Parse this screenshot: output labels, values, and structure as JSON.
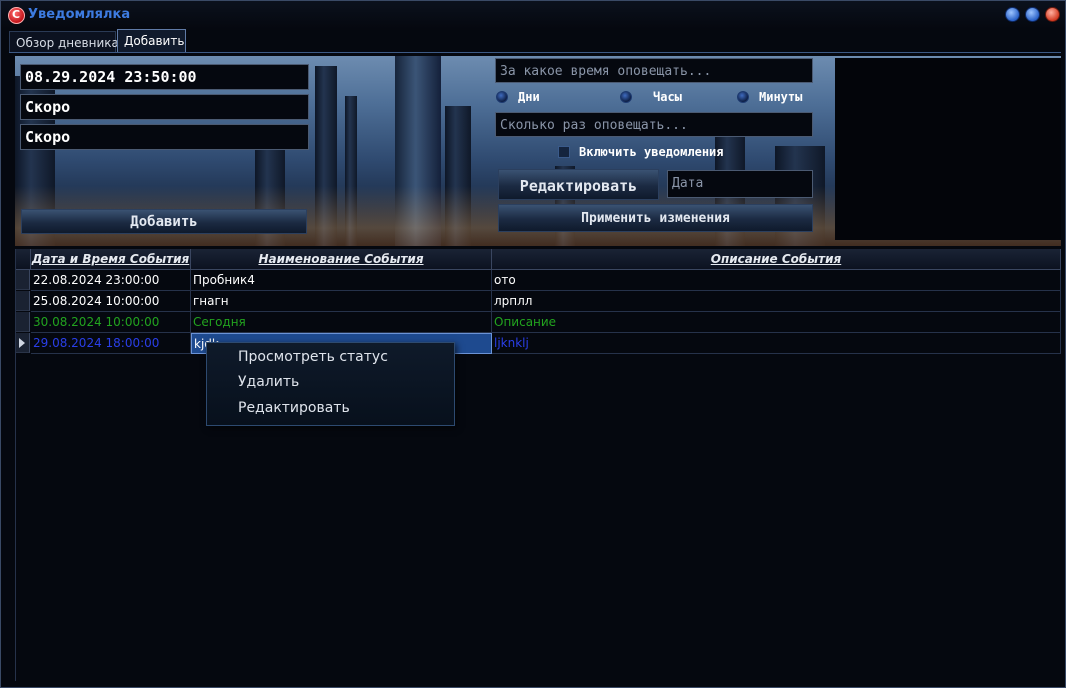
{
  "window": {
    "title": "Уведомлялка",
    "controls": [
      "minimize-button",
      "maximize-button",
      "close-button"
    ]
  },
  "tabs": [
    {
      "label": "Обзор дневника",
      "active": false
    },
    {
      "label": "Добавить",
      "active": true
    }
  ],
  "form": {
    "datetime_value": "08.29.2024 23:50:00",
    "name_value": "Скоро",
    "description_value": "Скоро",
    "add_button": "Добавить",
    "notify_time_placeholder": "За какое время оповещать...",
    "radio_options": [
      "Дни",
      "Часы",
      "Минуты"
    ],
    "repeat_placeholder": "Сколько раз оповещать...",
    "enable_notifications_label": "Включить уведомления",
    "enable_notifications_checked": false,
    "edit_button": "Редактировать",
    "date_placeholder": "Дата",
    "apply_button": "Применить изменения"
  },
  "table": {
    "columns": [
      "Дата и Время События",
      "Наименование События",
      "Описание События"
    ],
    "rows": [
      {
        "date": "22.08.2024 23:00:00",
        "name": "Пробник4",
        "description": "ото",
        "color": "#ffffff"
      },
      {
        "date": "25.08.2024 10:00:00",
        "name": "гнагн",
        "description": "лрплл",
        "color": "#ffffff"
      },
      {
        "date": "30.08.2024 10:00:00",
        "name": "Сегодня",
        "description": "Описание",
        "color": "#22a31f"
      },
      {
        "date": "29.08.2024 18:00:00",
        "name": "kjdk",
        "description": "ljknklj",
        "color": "#2a3fe8",
        "current": true
      }
    ]
  },
  "context_menu": {
    "items": [
      "Просмотреть статус",
      "Удалить",
      "Редактировать"
    ]
  }
}
